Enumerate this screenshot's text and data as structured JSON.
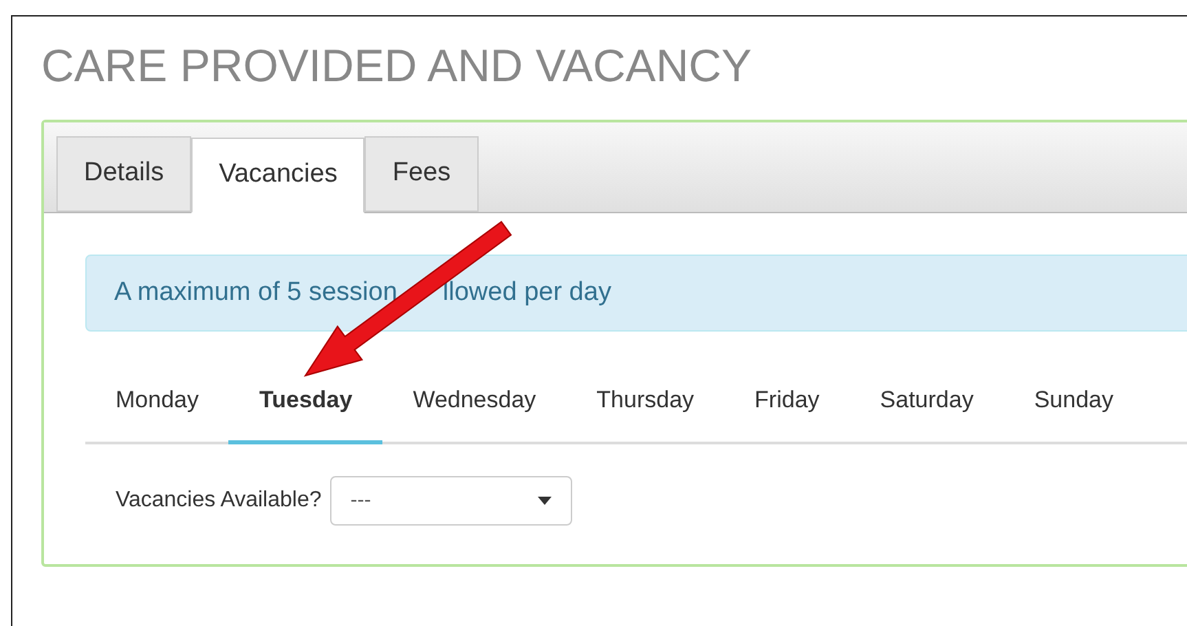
{
  "page_title": "CARE PROVIDED AND VACANCY",
  "tabs": [
    {
      "label": "Details",
      "selected": false
    },
    {
      "label": "Vacancies",
      "selected": true
    },
    {
      "label": "Fees",
      "selected": false
    }
  ],
  "alert": [
    "A maximum of 5 session",
    "llowed per day"
  ],
  "day_tabs": [
    {
      "label": "Monday",
      "selected": false
    },
    {
      "label": "Tuesday",
      "selected": true
    },
    {
      "label": "Wednesday",
      "selected": false
    },
    {
      "label": "Thursday",
      "selected": false
    },
    {
      "label": "Friday",
      "selected": false
    },
    {
      "label": "Saturday",
      "selected": false
    },
    {
      "label": "Sunday",
      "selected": false
    }
  ],
  "vacancies_field": {
    "label": "Vacancies Available?",
    "value": "---"
  }
}
